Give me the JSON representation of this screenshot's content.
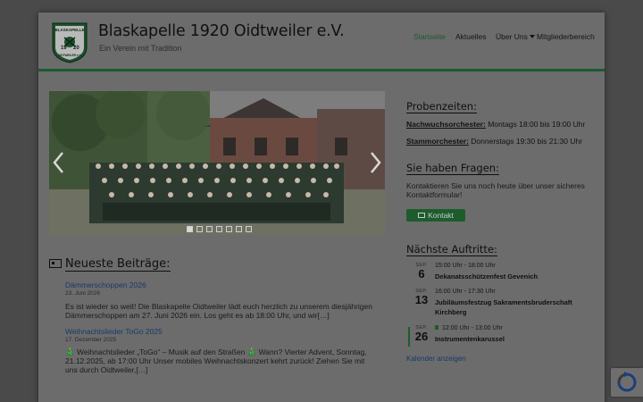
{
  "header": {
    "title": "Blaskapelle 1920 Oidtweiler e.V.",
    "subtitle": "Ein Verein mit Tradition",
    "logo": {
      "text_top": "BLASKAPELLE",
      "year_left": "19",
      "year_right": "20",
      "text_bottom": "OIDTWEILER e.V."
    }
  },
  "nav": {
    "items": [
      "Startseite",
      "Aktuelles",
      "Über Uns",
      "Mitgliederbereich"
    ],
    "active": "Startseite"
  },
  "slider": {
    "slide_count": 7,
    "active_slide": 1,
    "prev_icon": "chevron-left-icon",
    "next_icon": "chevron-right-icon"
  },
  "probenzeiten": {
    "heading": "Probenzeiten:",
    "rows": [
      {
        "label": "Nachwuchsorchester:",
        "value": "Montags 18:00 bis 19:00 Uhr"
      },
      {
        "label": "Stammorchester:",
        "value": "Donnerstags 19:30 bis 21:30 Uhr"
      }
    ]
  },
  "fragen": {
    "heading": "Sie haben Fragen:",
    "text": "Kontaktieren Sie uns noch heute über unser sicheres Kontaktformular!",
    "button": "Kontakt"
  },
  "auftritte": {
    "heading": "Nächste Auftritte:",
    "events": [
      {
        "month": "SEP.",
        "day": "6",
        "time": "15:00 Uhr - 18:00 Uhr",
        "name": "Dekanatsschützenfest Gevenich"
      },
      {
        "month": "SEP.",
        "day": "13",
        "time": "16:00 Uhr - 17:30 Uhr",
        "name": "Jubiläumsfestzug Sakramentsbruderschaft Kirchberg"
      },
      {
        "month": "SEP.",
        "day": "26",
        "time": "12:00 Uhr - 13:00 Uhr",
        "name": "Instrumentenkarussel"
      }
    ],
    "calendar_link": "Kalender anzeigen"
  },
  "news": {
    "heading": "Neueste Beiträge:",
    "posts": [
      {
        "title": "Dämmerschoppen 2026",
        "date": "23. Juni 2026",
        "excerpt": "Es ist wieder so weit! Die Blaskapelle Oidtweiler lädt euch herzlich zu unserem diesjährigen Dämmerschoppen am 27. Juni 2026 ein. Los geht es ab 18:00 Uhr, und wir[…]"
      },
      {
        "title": "Weihnachtslieder ToGo 2025",
        "date": "17. Dezember 2025",
        "excerpt": "🎄 Weihnachtslieder „ToGo“ – Musik auf den Straßen 🎄 Wann? Vierter Advent, Sonntag, 21.12.2025, ab 17:00 Uhr Unser mobiles Weihnachtskonzert kehrt zurück! Ziehen Sie mit uns durch Oidtweiler,[…]"
      }
    ]
  },
  "colors": {
    "accent": "#1d5c2d",
    "link": "#173b6a",
    "page": "#6c6c6c",
    "overlay": "#4a4a4a"
  }
}
